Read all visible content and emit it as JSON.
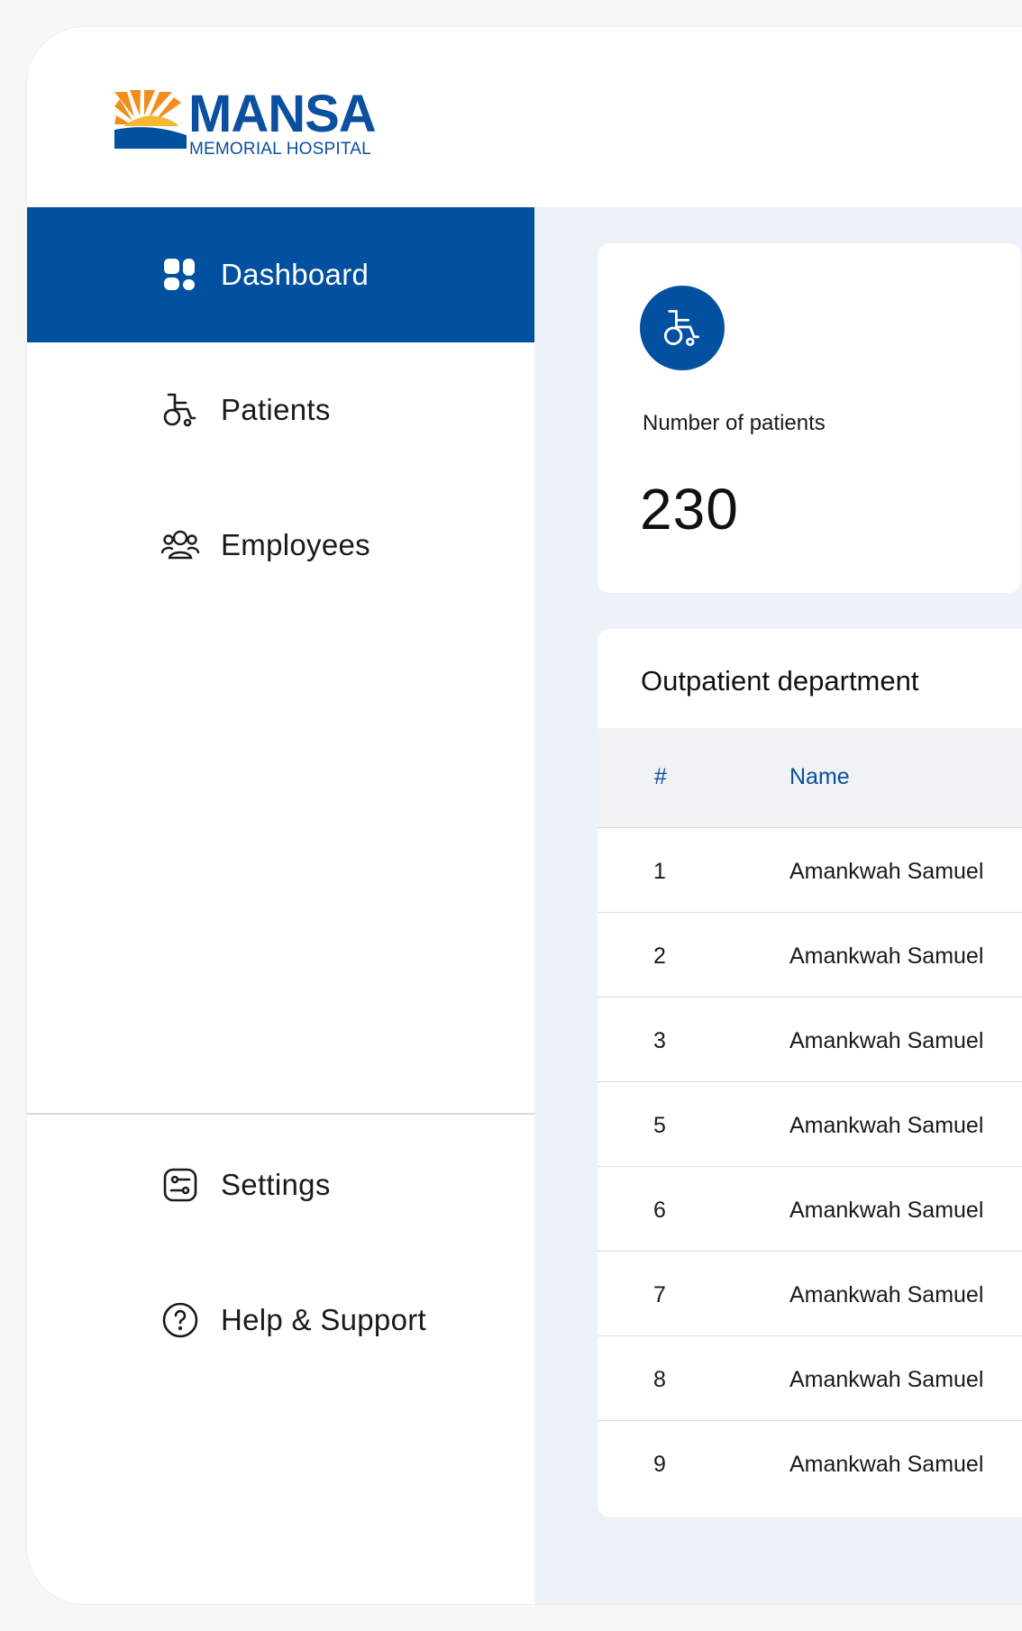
{
  "brand": {
    "name": "MANSA",
    "subtitle": "MEMORIAL HOSPITAL",
    "colors": {
      "primary": "#0250a0",
      "sun": "#f28c1a",
      "sun_light": "#f7b733"
    }
  },
  "sidebar": {
    "items": [
      {
        "label": "Dashboard",
        "icon": "dashboard-icon",
        "active": true
      },
      {
        "label": "Patients",
        "icon": "wheelchair-icon",
        "active": false
      },
      {
        "label": "Employees",
        "icon": "users-icon",
        "active": false
      }
    ],
    "bottom_items": [
      {
        "label": "Settings",
        "icon": "settings-icon"
      },
      {
        "label": "Help & Support",
        "icon": "help-icon"
      }
    ]
  },
  "stats": {
    "patients": {
      "label": "Number of patients",
      "value": "230",
      "icon": "wheelchair-icon"
    }
  },
  "outpatient": {
    "title": "Outpatient department",
    "columns": [
      "#",
      "Name"
    ],
    "rows": [
      {
        "num": "1",
        "name": "Amankwah Samuel"
      },
      {
        "num": "2",
        "name": "Amankwah Samuel"
      },
      {
        "num": "3",
        "name": "Amankwah Samuel"
      },
      {
        "num": "5",
        "name": "Amankwah Samuel"
      },
      {
        "num": "6",
        "name": "Amankwah Samuel"
      },
      {
        "num": "7",
        "name": "Amankwah Samuel"
      },
      {
        "num": "8",
        "name": "Amankwah Samuel"
      },
      {
        "num": "9",
        "name": "Amankwah Samuel"
      }
    ]
  }
}
